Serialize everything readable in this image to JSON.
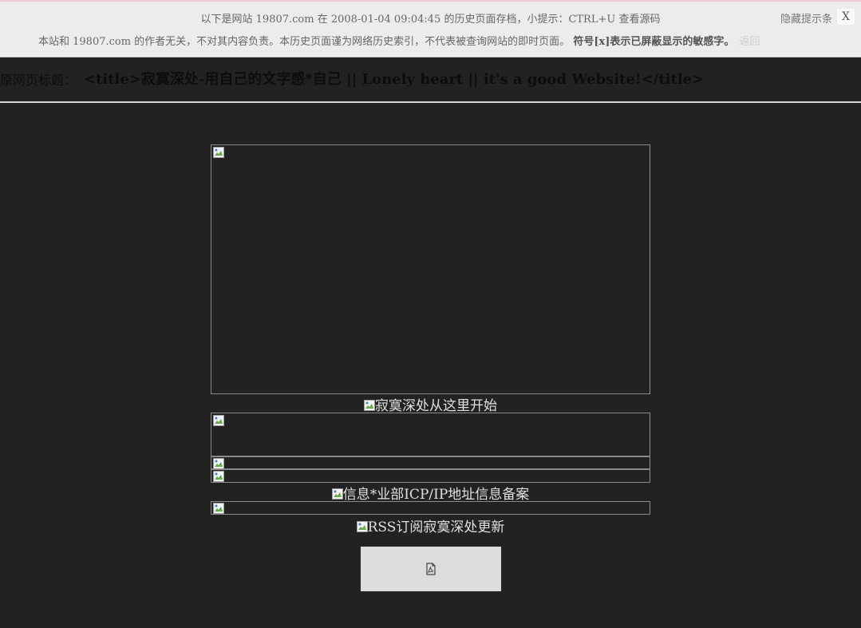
{
  "notice": {
    "line1": "以下是网站 19807.com 在 2008-01-04 09:04:45 的历史页面存档，小提示：CTRL+U 查看源码",
    "line2_prefix": "本站和 19807.com 的作者无关，不对其内容负责。本历史页面谨为网络历史索引，不代表被查询网站的即时页面。",
    "line2_bold": "符号[x]表示已屏蔽显示的敏感字。",
    "back_label": "返回",
    "hide_label": "隐藏提示条",
    "close_label": "X"
  },
  "original_title": {
    "label": "原网页标题：",
    "value": "<title>寂寞深处-用自己的文字感*自己 || Lonely heart || it's a good Website!</title>"
  },
  "images": {
    "banner_alt": "",
    "start_alt": "寂寞深处从这里开始",
    "icp_alt": "信息*业部ICP/IP地址信息备案",
    "rss_alt": "RSS订阅寂寞深处更新"
  },
  "icons": {
    "broken_image": "broken-image-icon",
    "pdf": "pdf-file-icon"
  },
  "colors": {
    "page_bg": "#222222",
    "notice_bg": "#ececec",
    "box_border": "#8a8a8a",
    "alt_text": "#e0e0e0"
  }
}
